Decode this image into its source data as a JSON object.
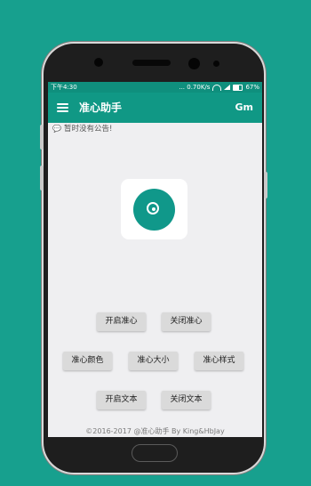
{
  "status_bar": {
    "time": "下午4:30",
    "network": "... 0.70K/s",
    "battery": "67%"
  },
  "app_bar": {
    "title": "准心助手",
    "right_label": "Gm"
  },
  "notice": {
    "text": "暂时没有公告!"
  },
  "buttons": {
    "open_crosshair": "开启准心",
    "close_crosshair": "关闭准心",
    "crosshair_color": "准心颜色",
    "crosshair_size": "准心大小",
    "crosshair_style": "准心样式",
    "open_text": "开启文本",
    "close_text": "关闭文本"
  },
  "footer": {
    "copyright": "©2016-2017 @准心助手 By King&HbJay"
  },
  "colors": {
    "background": "#17a08e",
    "app_bar": "#109885",
    "status_bar": "#0f8f7d",
    "button": "#dadada"
  }
}
